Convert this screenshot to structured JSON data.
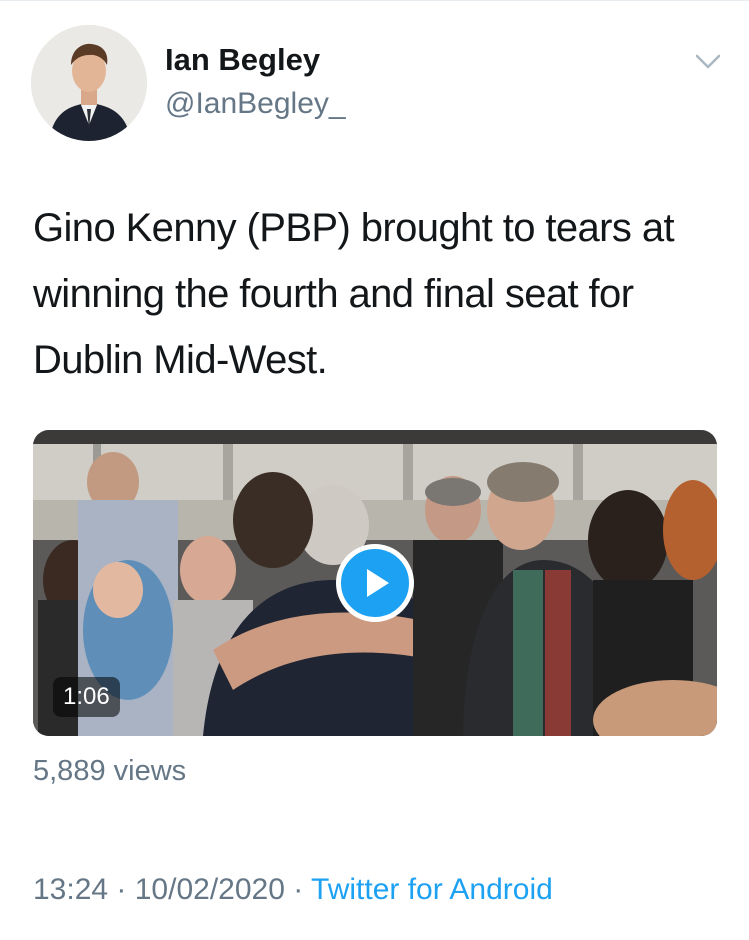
{
  "author": {
    "name": "Ian Begley",
    "handle": "@IanBegley_"
  },
  "tweet": {
    "text": "Gino Kenny (PBP) brought to tears at winning the fourth and final seat for Dublin Mid-West."
  },
  "media": {
    "duration": "1:06"
  },
  "stats": {
    "views": "5,889 views"
  },
  "meta": {
    "time": "13:24",
    "separator1": " · ",
    "date": "10/02/2020",
    "separator2": " · ",
    "source": "Twitter for Android"
  },
  "colors": {
    "accent": "#1da1f2",
    "secondary_text": "#657786",
    "primary_text": "#14171a"
  }
}
